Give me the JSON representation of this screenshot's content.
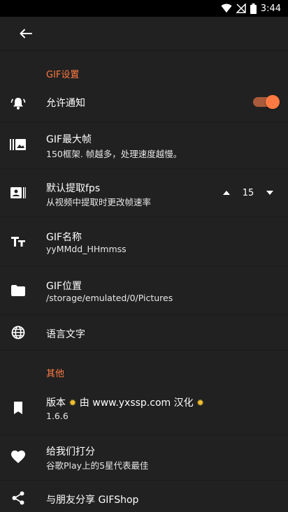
{
  "status_bar": {
    "time": "3:44"
  },
  "app_bar": {
    "back_icon": "arrow-back-icon"
  },
  "sections": {
    "gif_settings": "GIF设置",
    "other": "其他"
  },
  "settings": {
    "allow_notify": {
      "title": "允许通知",
      "toggle_on": true
    },
    "max_frames": {
      "title": "GIF最大帧",
      "subtitle": "150框架. 帧越多，处理速度越慢。"
    },
    "default_fps": {
      "title": "默认提取fps",
      "subtitle": "从视频中提取时更改帧速率",
      "value": "15"
    },
    "gif_name": {
      "title": "GIF名称",
      "subtitle": "yyMMdd_HHmmss"
    },
    "gif_location": {
      "title": "GIF位置",
      "subtitle": "/storage/emulated/0/Pictures"
    },
    "language": {
      "title": "语言文字"
    }
  },
  "other": {
    "version": {
      "title_pre": "版本",
      "title_mid": " 由 www.yxssp.com 汉化 ",
      "sun_glyph": "✹",
      "subtitle": "1.6.6"
    },
    "rate": {
      "title": "给我们打分",
      "subtitle": "谷歌Play上的5星代表最佳"
    },
    "share": {
      "title": "与朋友分享 GIFShop"
    }
  },
  "colors": {
    "accent": "#ff7a42",
    "background": "#212121",
    "status_bar": "#000000"
  }
}
